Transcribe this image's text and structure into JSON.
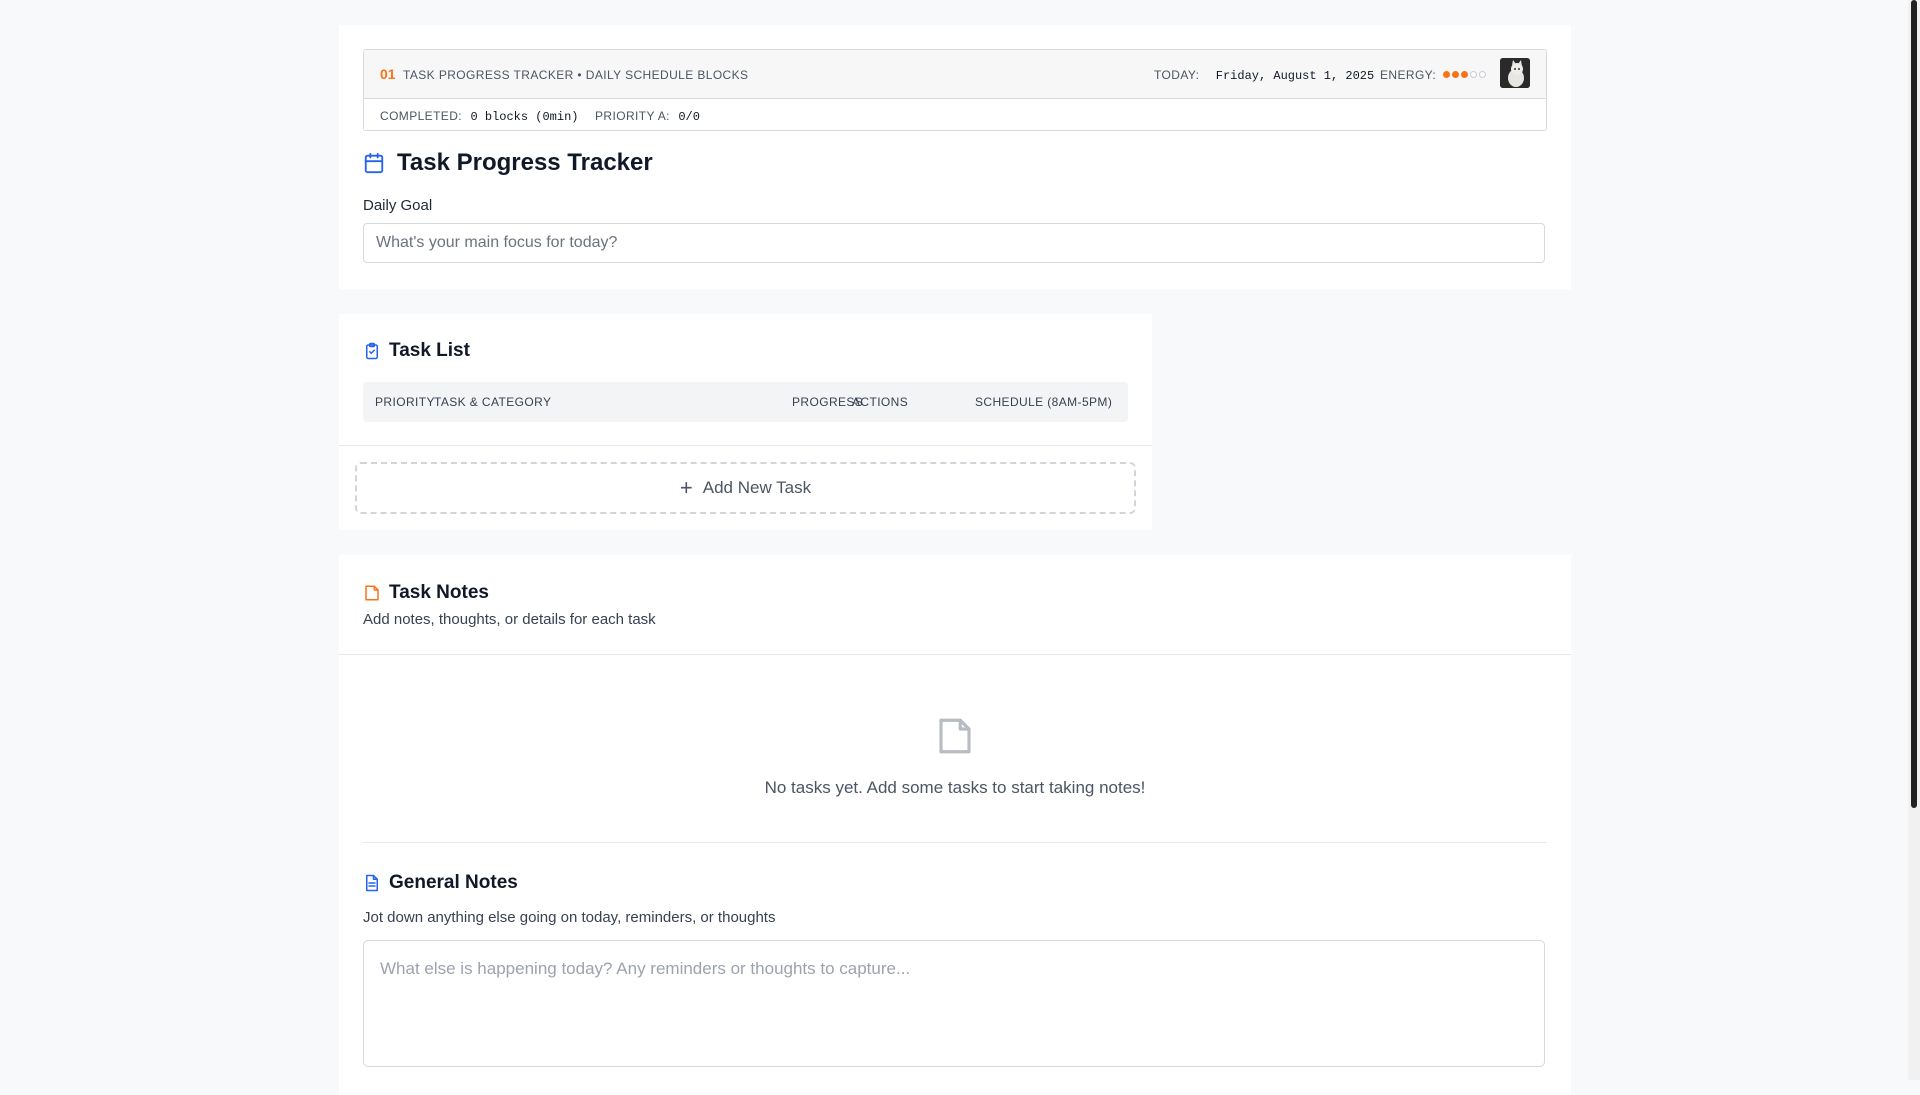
{
  "header": {
    "number": "01",
    "title": "TASK PROGRESS TRACKER • DAILY SCHEDULE BLOCKS",
    "today_label": "TODAY:",
    "today_value": "Friday, August 1, 2025",
    "energy_label": "ENERGY:",
    "energy_level": 3,
    "energy_max": 5,
    "completed_label": "COMPLETED:",
    "completed_value": "0 blocks (0min)",
    "priority_label": "PRIORITY A:",
    "priority_value": "0/0"
  },
  "main": {
    "title": "Task Progress Tracker",
    "goal_label": "Daily Goal",
    "goal_placeholder": "What's your main focus for today?",
    "goal_value": ""
  },
  "task_list": {
    "title": "Task List",
    "columns": [
      "PRIORITY",
      "TASK & CATEGORY",
      "PROGRESS",
      "ACTIONS",
      "SCHEDULE (8AM-5PM)"
    ],
    "add_label": "Add New Task"
  },
  "task_notes": {
    "title": "Task Notes",
    "subtitle": "Add notes, thoughts, or details for each task",
    "empty_text": "No tasks yet. Add some tasks to start taking notes!"
  },
  "general_notes": {
    "title": "General Notes",
    "subtitle": "Jot down anything else going on today, reminders, or thoughts",
    "placeholder": "What else is happening today? Any reminders or thoughts to capture...",
    "value": ""
  },
  "colors": {
    "accent": "#f97316",
    "icon_blue": "#2563eb",
    "icon_orange": "#f97316"
  },
  "icons": {
    "calendar": "calendar-icon",
    "clipboard": "clipboard-check-icon",
    "note": "sticky-note-icon",
    "document": "document-icon",
    "plus": "plus-icon",
    "empty": "empty-note-icon"
  }
}
